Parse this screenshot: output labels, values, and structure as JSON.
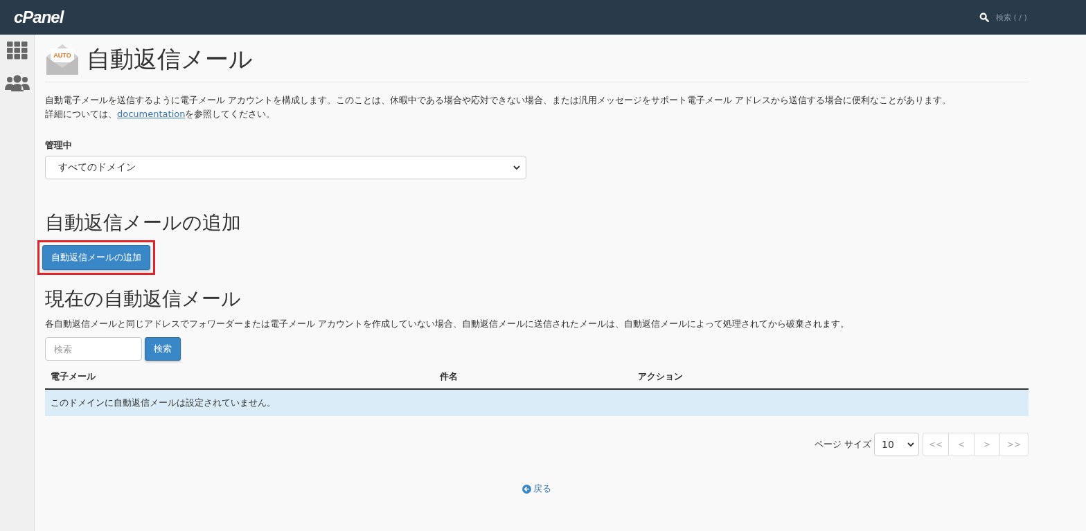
{
  "topbar": {
    "logo": "cPanel",
    "search_placeholder": "検索 ( / )"
  },
  "sidebar": {
    "items": [
      {
        "kind": "grid"
      },
      {
        "kind": "users"
      }
    ]
  },
  "page": {
    "icon_label": "AUTO",
    "title": "自動返信メール",
    "intro_lines": [
      "自動電子メールを送信するように電子メール アカウントを構成します。このことは、休暇中である場合や応対できない場合、または汎用メッセージをサポート電子メール アドレスから送信する場合に便利なことがあります。"
    ],
    "intro_link_prefix": "詳細については、",
    "intro_link": "documentation",
    "intro_link_suffix": "を参照してください。"
  },
  "managing": {
    "label": "管理中",
    "value": "すべてのドメイン"
  },
  "add_section": {
    "heading": "自動返信メールの追加",
    "button": "自動返信メールの追加",
    "highlighted": true
  },
  "current_section": {
    "heading": "現在の自動返信メール",
    "note": "各自動返信メールと同じアドレスでフォワーダーまたは電子メール アカウントを作成していない場合、自動返信メールに送信されたメールは、自動返信メールによって処理されてから破棄されます。",
    "search_placeholder": "検索",
    "search_button": "検索"
  },
  "table": {
    "columns": [
      "電子メール",
      "件名",
      "アクション"
    ],
    "empty_message": "このドメインに自動返信メールは設定されていません。"
  },
  "pagination": {
    "page_size_label": "ページ サイズ",
    "page_size": "10",
    "buttons": [
      {
        "label": "<<",
        "disabled": true
      },
      {
        "label": "<",
        "disabled": true
      },
      {
        "label": ">",
        "disabled": true
      },
      {
        "label": ">>",
        "disabled": true
      }
    ]
  },
  "back_link": "戻る"
}
